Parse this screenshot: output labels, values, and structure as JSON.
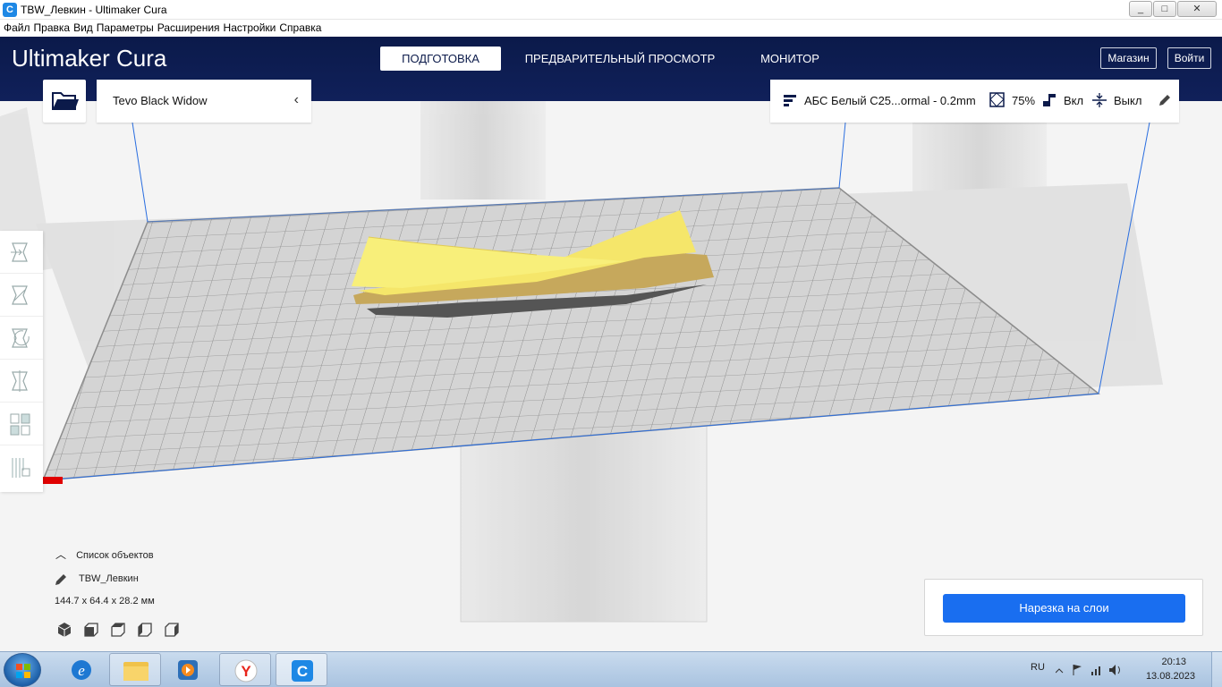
{
  "window": {
    "title": "TBW_Левкин - Ultimaker Cura",
    "controls": [
      "_",
      "□",
      "✕"
    ]
  },
  "menu": [
    "Файл",
    "Правка",
    "Вид",
    "Параметры",
    "Расширения",
    "Настройки",
    "Справка"
  ],
  "header": {
    "logo_bold": "Ultimaker",
    "logo_light": "Cura",
    "stages": [
      "ПОДГОТОВКА",
      "ПРЕДВАРИТЕЛЬНЫЙ ПРОСМОТР",
      "МОНИТОР"
    ],
    "active_stage": "ПОДГОТОВКА",
    "marketplace": "Магазин",
    "signin": "Войти"
  },
  "printer": {
    "name": "Tevo Black Widow"
  },
  "print_settings": {
    "profile": "АБС Белый C25...ormal - 0.2mm",
    "infill": "75%",
    "support": "Вкл",
    "adhesion": "Выкл"
  },
  "object_list": {
    "title": "Список объектов",
    "object_name": "TBW_Левкин",
    "dimensions": "144.7 x 64.4 x 28.2 мм"
  },
  "slice": {
    "button": "Нарезка на слои"
  },
  "taskbar": {
    "lang": "RU",
    "time": "20:13",
    "date": "13.08.2023"
  },
  "colors": {
    "header": "#0b1a4a",
    "accent": "#196ef0",
    "model": "#f5e66a",
    "model_shadow": "#c8aa5a"
  }
}
